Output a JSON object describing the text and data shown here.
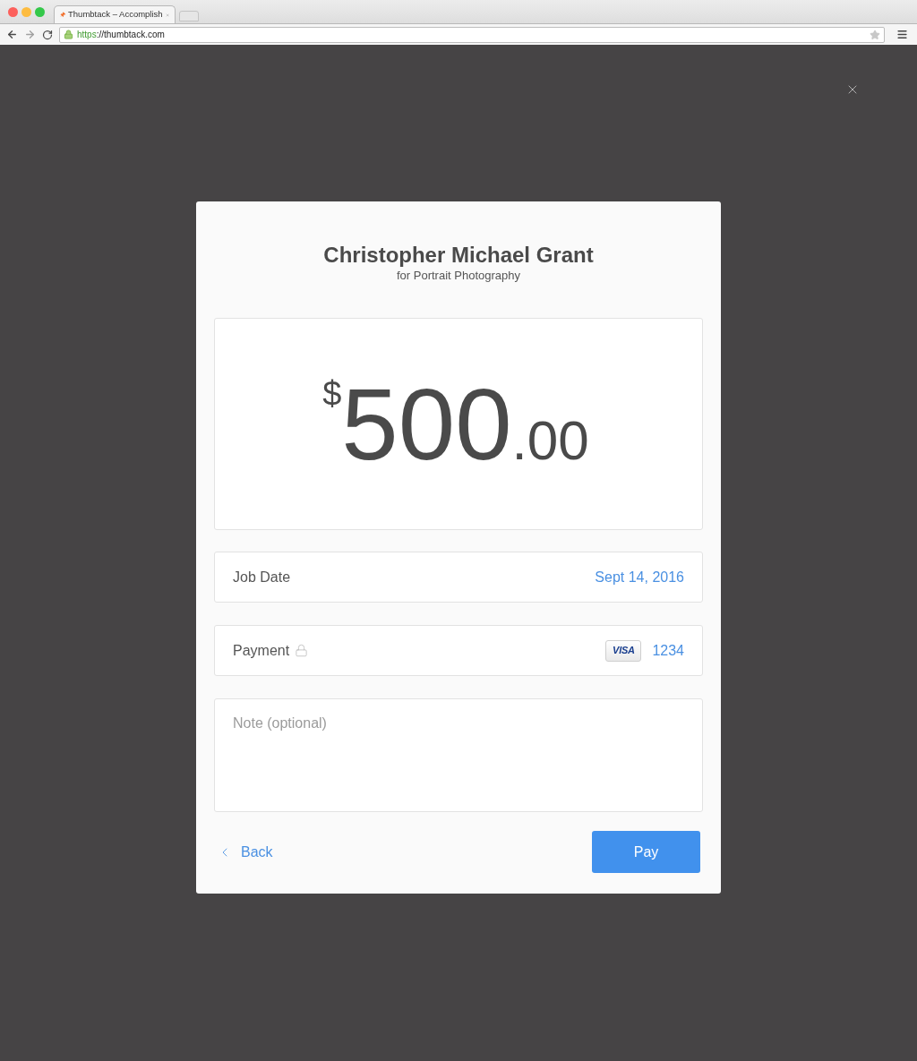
{
  "browser": {
    "tab": {
      "title": "Thumbtack – Accomplish",
      "selected": true
    },
    "address": {
      "scheme": "https",
      "rest": "://thumbtack.com"
    }
  },
  "modal": {
    "title": "Christopher Michael Grant",
    "subtitle": "for Portrait Photography",
    "amount": {
      "currency": "$",
      "whole": "500",
      "separator": ".",
      "cents": "00"
    },
    "rows": [
      {
        "kind": "date",
        "label": "Job Date",
        "value": "Sept 14, 2016"
      },
      {
        "kind": "payment",
        "label": "Payment",
        "card_brand": "VISA",
        "value": "1234"
      }
    ],
    "note": {
      "placeholder": "Note (optional)"
    },
    "back": "Back",
    "pay": "Pay"
  }
}
